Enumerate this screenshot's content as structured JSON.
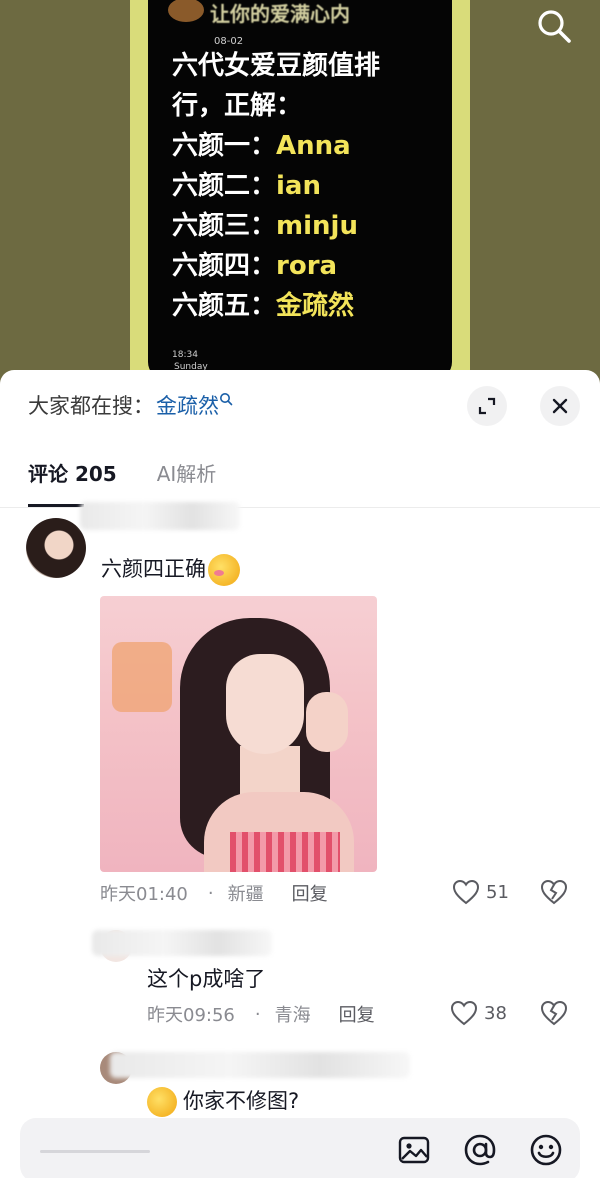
{
  "video": {
    "overlay_title": "让你的爱满心内",
    "overlay_date": "08-02",
    "lines": [
      {
        "prefix": "六代女爱豆颜值排",
        "value": ""
      },
      {
        "prefix": "行，正解：",
        "value": ""
      },
      {
        "prefix": "六颜一：",
        "value": "Anna"
      },
      {
        "prefix": "六颜二：",
        "value": "ian"
      },
      {
        "prefix": "六颜三：",
        "value": "minju"
      },
      {
        "prefix": "六颜四：",
        "value": "rora"
      },
      {
        "prefix": "六颜五：",
        "value": "金疏然"
      }
    ],
    "screen_time": "18:34",
    "screen_day": "Sunday"
  },
  "sheet": {
    "suggest_label": "大家都在搜：",
    "suggest_term": "金疏然",
    "tabs": [
      {
        "label": "评论 205",
        "active": true
      },
      {
        "label": "AI解析",
        "active": false
      }
    ]
  },
  "comments": [
    {
      "text": "六颜四正确",
      "time": "昨天01:40",
      "dot": "·",
      "location": "新疆",
      "reply_label": "回复",
      "likes": "51"
    }
  ],
  "replies": [
    {
      "text": "这个p成啥了",
      "time": "昨天09:56",
      "dot": "·",
      "location": "青海",
      "reply_label": "回复",
      "likes": "38"
    },
    {
      "text": "你家不修图?"
    }
  ],
  "colors": {
    "accent_link": "#1a5fa8",
    "text_primary": "#161823",
    "text_secondary": "#8a8b91",
    "video_bg": "#6d6a41",
    "highlight_yellow": "#f3e45a"
  },
  "icons": {
    "top_right": "search-icon",
    "expand": "expand-icon",
    "close": "close-icon",
    "like": "heart-icon",
    "dislike": "broken-heart-icon",
    "input_image": "image-icon",
    "input_mention": "at-icon",
    "input_emoji": "emoji-icon"
  }
}
